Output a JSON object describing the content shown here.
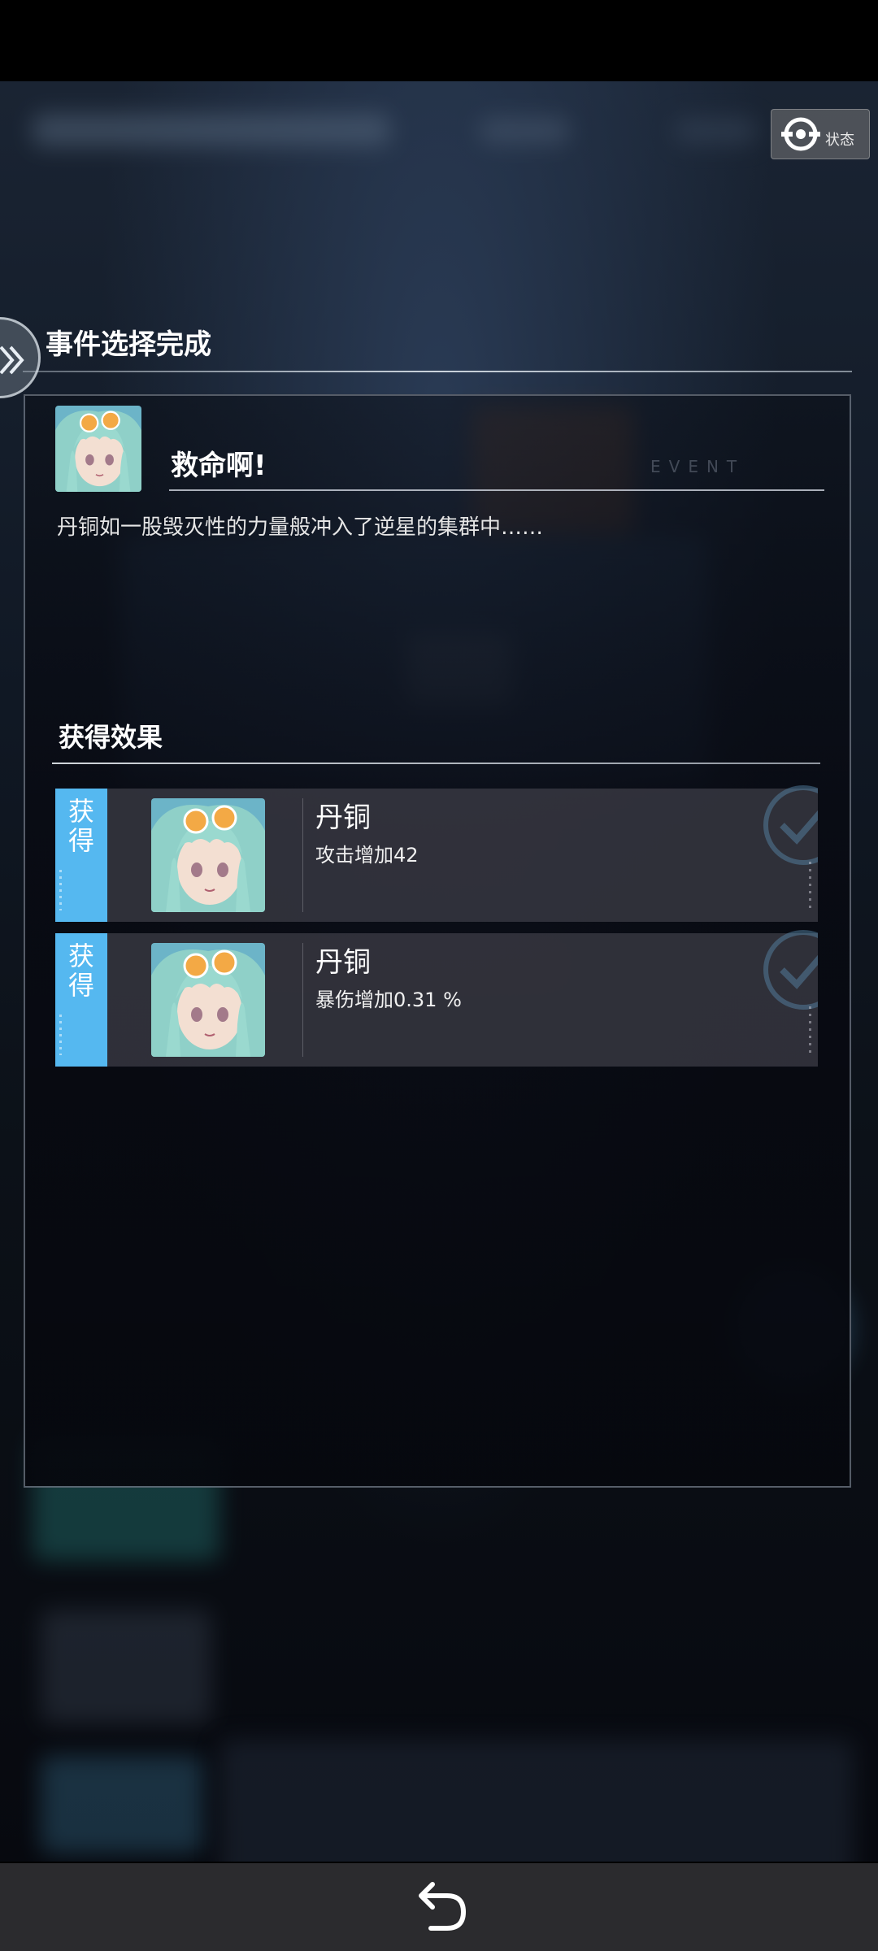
{
  "status_button": {
    "label": "状态",
    "icon": "target-icon"
  },
  "side_tab": {
    "icon": "double-chevron-right-icon"
  },
  "header": {
    "title": "事件选择完成"
  },
  "event": {
    "avatar_icon": "character-portrait",
    "title": "救命啊!",
    "watermark": "EVENT",
    "description": "丹铜如一股毁灭性的力量般冲入了逆星的集群中……"
  },
  "effects": {
    "title": "获得效果",
    "items": [
      {
        "tag": "获得",
        "name": "丹铜",
        "detail": "攻击增加42"
      },
      {
        "tag": "获得",
        "name": "丹铜",
        "detail": "暴伤增加0.31 %"
      }
    ]
  },
  "bottom_bar": {
    "back_icon": "undo-arrow-icon"
  },
  "colors": {
    "tag_blue": "#55b8f0",
    "row_bg": "#3e3e48",
    "bottom_bar": "#2b2b2e"
  }
}
